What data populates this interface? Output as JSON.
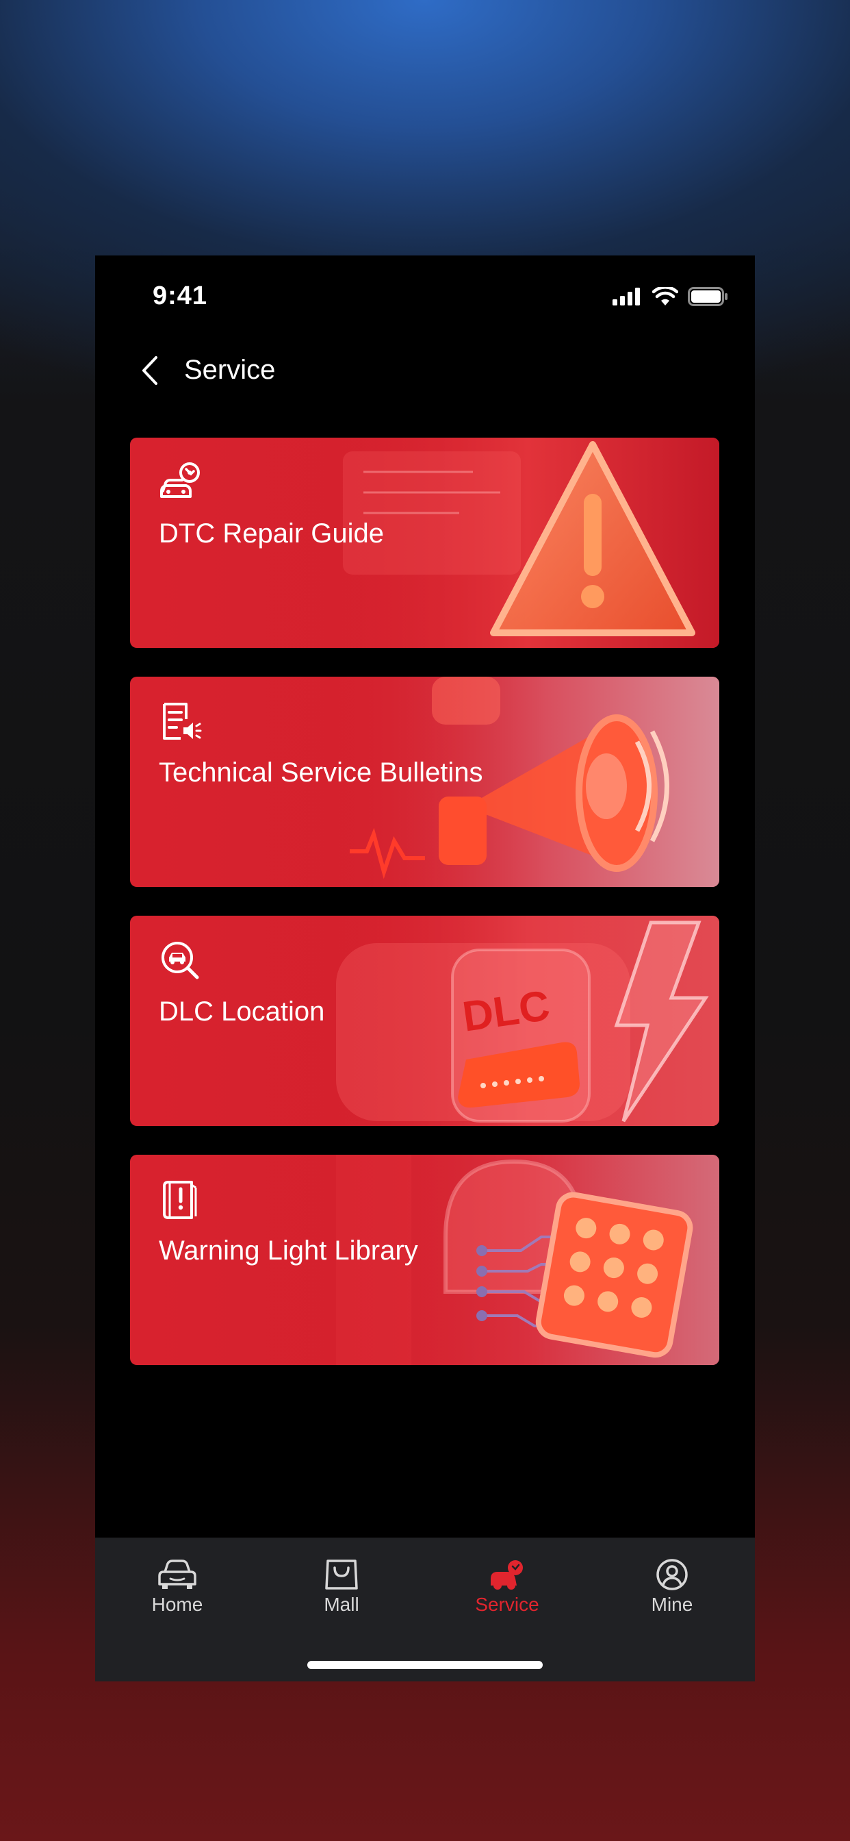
{
  "status_bar": {
    "time": "9:41"
  },
  "header": {
    "title": "Service"
  },
  "cards": [
    {
      "title": "DTC Repair Guide",
      "icon": "car-wrench-icon"
    },
    {
      "title": "Technical Service Bulletins",
      "icon": "bulletin-speaker-icon"
    },
    {
      "title": "DLC Location",
      "icon": "search-car-icon"
    },
    {
      "title": "Warning Light Library",
      "icon": "warning-book-icon"
    }
  ],
  "tabbar": {
    "items": [
      {
        "label": "Home",
        "icon": "car-icon",
        "active": false
      },
      {
        "label": "Mall",
        "icon": "shopping-bag-icon",
        "active": false
      },
      {
        "label": "Service",
        "icon": "service-icon",
        "active": true
      },
      {
        "label": "Mine",
        "icon": "user-icon",
        "active": false
      }
    ]
  },
  "colors": {
    "accent": "#e1252e",
    "card_red": "#d8222e",
    "tabbar_bg": "#202124"
  }
}
